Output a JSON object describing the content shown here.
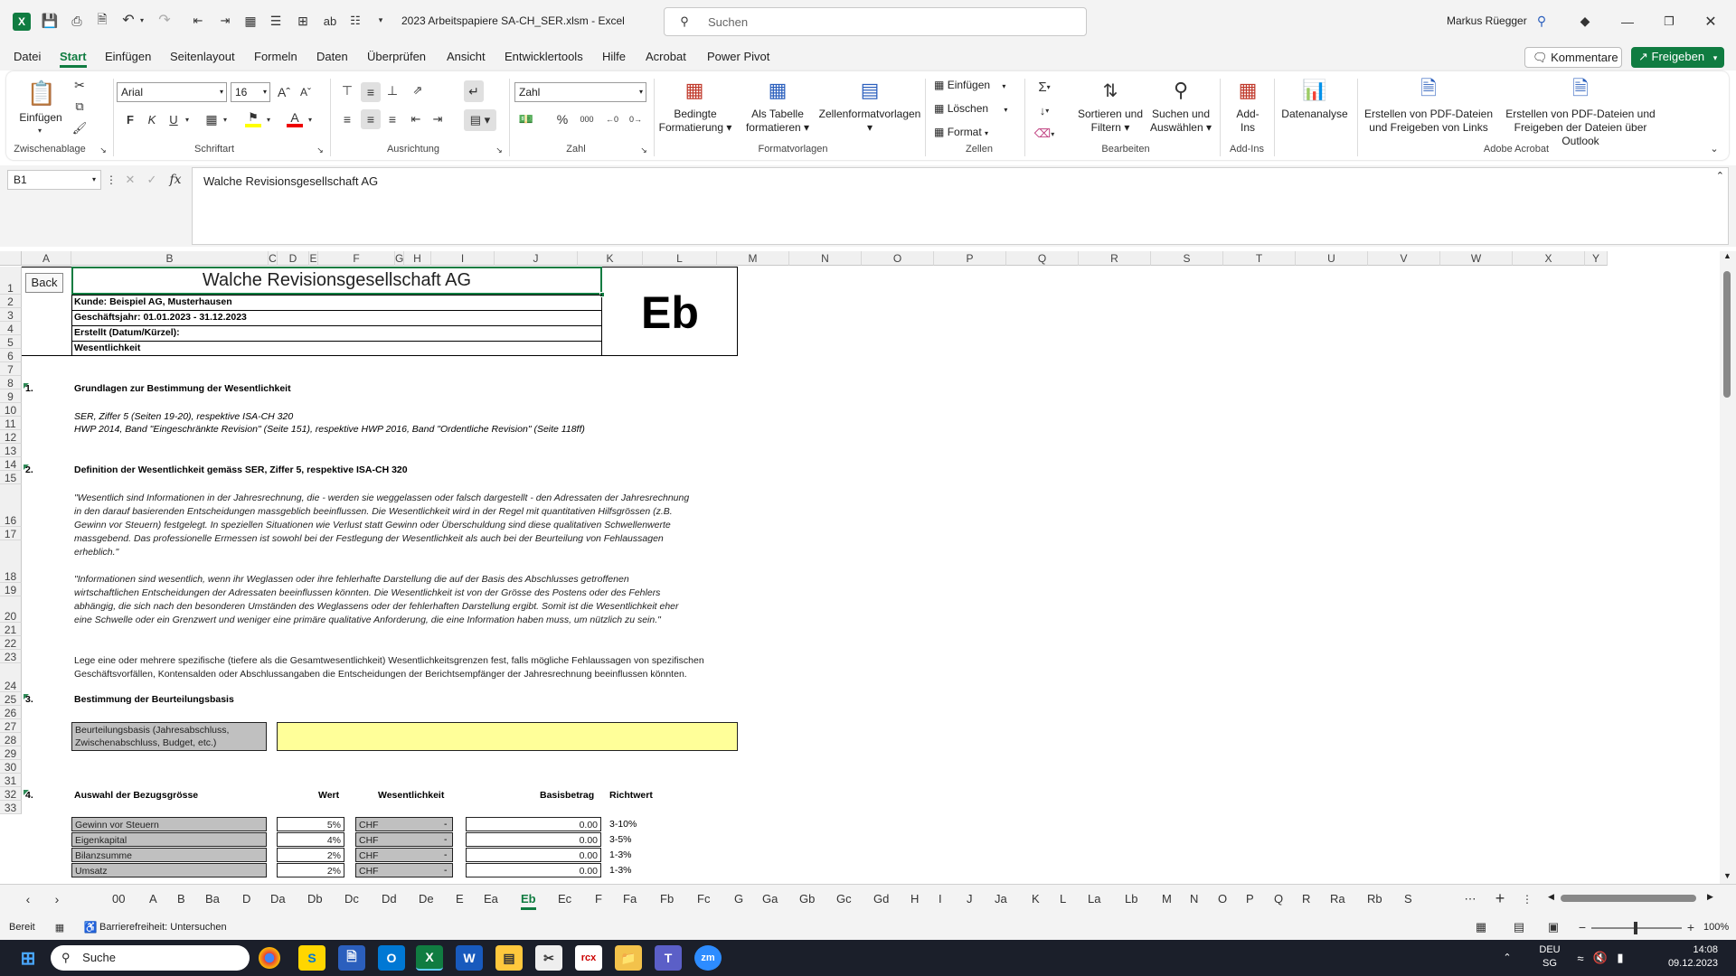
{
  "titlebar": {
    "filename": "2023 Arbeitspapiere SA-CH_SER.xlsm",
    "separator": "-",
    "app": "Excel",
    "search_placeholder": "Suchen",
    "user": "Markus Rüegger"
  },
  "menu": [
    "Datei",
    "Start",
    "Einfügen",
    "Seitenlayout",
    "Formeln",
    "Daten",
    "Überprüfen",
    "Ansicht",
    "Entwicklertools",
    "Hilfe",
    "Acrobat",
    "Power Pivot"
  ],
  "menu_buttons": {
    "comments": "Kommentare",
    "share": "Freigeben"
  },
  "ribbon": {
    "clipboard": {
      "paste": "Einfügen",
      "group": "Zwischenablage"
    },
    "font": {
      "name": "Arial",
      "size": "16",
      "bold": "F",
      "italic": "K",
      "underline": "U",
      "group": "Schriftart"
    },
    "alignment": {
      "group": "Ausrichtung"
    },
    "number": {
      "format": "Zahl",
      "group": "Zahl"
    },
    "styles": {
      "cond1": "Bedingte",
      "cond2": "Formatierung",
      "table1": "Als Tabelle",
      "table2": "formatieren",
      "cell": "Zellenformatvorlagen",
      "group": "Formatvorlagen"
    },
    "cells": {
      "insert": "Einfügen",
      "delete": "Löschen",
      "format": "Format",
      "group": "Zellen"
    },
    "editing": {
      "sort1": "Sortieren und",
      "sort2": "Filtern",
      "find1": "Suchen und",
      "find2": "Auswählen",
      "group": "Bearbeiten"
    },
    "addins": {
      "l1": "Add-",
      "l2": "Ins",
      "group": "Add-Ins"
    },
    "analyze": {
      "label": "Datenanalyse"
    },
    "acrobat": {
      "a1": "Erstellen von PDF-Dateien",
      "a2": "und Freigeben von Links",
      "b1": "Erstellen von PDF-Dateien und",
      "b2": "Freigeben der Dateien über Outlook",
      "group": "Adobe Acrobat"
    }
  },
  "formula": {
    "namebox": "B1",
    "fx": "fx",
    "content": "Walche Revisionsgesellschaft AG"
  },
  "columns": [
    "A",
    "B",
    "C",
    "D",
    "E",
    "F",
    "G",
    "H",
    "I",
    "J",
    "K",
    "L",
    "M",
    "N",
    "O",
    "P",
    "Q",
    "R",
    "S",
    "T",
    "U",
    "V",
    "W",
    "X",
    "Y"
  ],
  "rows": [
    "1",
    "2",
    "3",
    "4",
    "5",
    "6",
    "7",
    "8",
    "9",
    "10",
    "11",
    "12",
    "13",
    "14",
    "15",
    "16",
    "17",
    "18",
    "19",
    "20",
    "21",
    "22",
    "23",
    "24",
    "25",
    "26",
    "27",
    "28",
    "29",
    "30",
    "31",
    "32",
    "33"
  ],
  "sheet": {
    "back": "Back",
    "title": "Walche Revisionsgesellschaft AG",
    "kunde": "Kunde: Beispiel AG, Musterhausen",
    "jahr": "Geschäftsjahr: 01.01.2023 - 31.12.2023",
    "erstellt": "Erstellt (Datum/Kürzel):",
    "wesentlichkeit": "Wesentlichkeit",
    "code": "Eb",
    "n1": "1.",
    "h1": "Grundlagen zur Bestimmung der Wesentlichkeit",
    "ref1": "SER, Ziffer 5 (Seiten 19-20), respektive ISA-CH 320",
    "ref2": "HWP 2014, Band \"Eingeschränkte Revision\" (Seite 151), respektive HWP 2016, Band \"Ordentliche Revision\" (Seite 118ff)",
    "n2": "2.",
    "h2": "Definition der Wesentlichkeit gemäss SER, Ziffer 5, respektive ISA-CH 320",
    "p1": [
      "\"Wesentlich sind Informationen in der Jahresrechnung, die - werden sie weggelassen oder falsch dargestellt - den Adressaten der Jahresrechnung",
      "in den darauf basierenden Entscheidungen massgeblich beeinflussen. Die Wesentlichkeit wird in der Regel mit quantitativen Hilfsgrössen (z.B.",
      "Gewinn vor Steuern) festgelegt. In speziellen Situationen wie Verlust statt Gewinn oder Überschuldung sind diese qualitativen Schwellenwerte",
      "massgebend. Das professionelle Ermessen ist sowohl bei der Festlegung der Wesentlichkeit als auch bei der Beurteilung von Fehlaussagen",
      "erheblich.\""
    ],
    "p2": [
      "\"Informationen sind wesentlich, wenn ihr Weglassen oder ihre fehlerhafte Darstellung die auf der Basis des Abschlusses getroffenen",
      "wirtschaftlichen Entscheidungen der Adressaten beeinflussen könnten. Die Wesentlichkeit ist von der Grösse des Postens oder des Fehlers",
      "abhängig, die sich nach den besonderen Umständen des Weglassens oder der fehlerhaften Darstellung ergibt. Somit ist die Wesentlichkeit eher",
      "eine Schwelle oder ein Grenzwert und weniger eine primäre qualitative Anforderung, die eine Information haben muss, um nützlich zu sein.\""
    ],
    "p3": [
      "Lege eine oder mehrere spezifische (tiefere als die Gesamtwesentlichkeit) Wesentlichkeitsgrenzen fest, falls mögliche Fehlaussagen von spezifischen",
      "Geschäftsvorfällen, Kontensalden oder Abschlussangaben die Entscheidungen der Berichtsempfänger der Jahresrechnung beeinflussen könnten."
    ],
    "n3": "3.",
    "h3": "Bestimmung der Beurteilungsbasis",
    "basis1": "Beurteilungsbasis (Jahresabschluss,",
    "basis2": "Zwischenabschluss, Budget, etc.)",
    "n4": "4.",
    "h4": "Auswahl der Bezugsgrösse",
    "col_wert": "Wert",
    "col_wes": "Wesentlichkeit",
    "col_basis": "Basisbetrag",
    "col_richt": "Richtwert",
    "table": [
      {
        "name": "Gewinn vor Steuern",
        "wert": "5%",
        "cur": "CHF",
        "wes": "-",
        "basis": "0.00",
        "richt": "3-10%"
      },
      {
        "name": "Eigenkapital",
        "wert": "4%",
        "cur": "CHF",
        "wes": "-",
        "basis": "0.00",
        "richt": "3-5%"
      },
      {
        "name": "Bilanzsumme",
        "wert": "2%",
        "cur": "CHF",
        "wes": "-",
        "basis": "0.00",
        "richt": "1-3%"
      },
      {
        "name": "Umsatz",
        "wert": "2%",
        "cur": "CHF",
        "wes": "-",
        "basis": "0.00",
        "richt": "1-3%"
      }
    ]
  },
  "sheet_tabs": [
    "00",
    "A",
    "B",
    "Ba",
    "D",
    "Da",
    "Db",
    "Dc",
    "Dd",
    "De",
    "E",
    "Ea",
    "Eb",
    "Ec",
    "F",
    "Fa",
    "Fb",
    "Fc",
    "G",
    "Ga",
    "Gb",
    "Gc",
    "Gd",
    "H",
    "I",
    "J",
    "Ja",
    "K",
    "L",
    "La",
    "Lb",
    "M",
    "N",
    "O",
    "P",
    "Q",
    "R",
    "Ra",
    "Rb",
    "S"
  ],
  "active_tab": "Eb",
  "status": {
    "ready": "Bereit",
    "accessibility": "Barrierefreiheit: Untersuchen",
    "zoom": "100%"
  },
  "taskbar": {
    "search": "Suche",
    "lang1": "DEU",
    "lang2": "SG",
    "time": "14:08",
    "date": "09.12.2023"
  }
}
